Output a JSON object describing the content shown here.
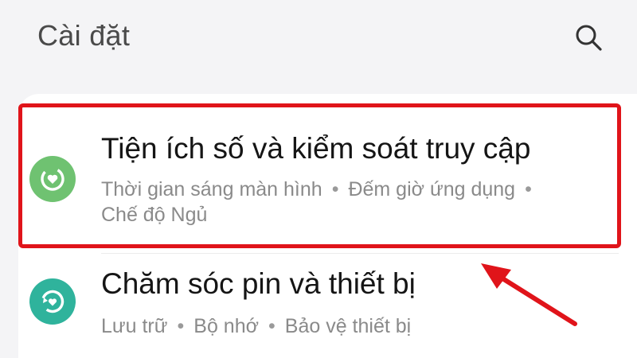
{
  "header": {
    "title": "Cài đặt",
    "search_icon": "search-icon"
  },
  "items": [
    {
      "title": "Tiện ích số và kiểm soát truy cập",
      "subtitle_parts": [
        "Thời gian sáng màn hình",
        "Đếm giờ ứng dụng",
        "Chế độ Ngủ"
      ],
      "separator": "•",
      "icon": "digital-wellbeing-icon",
      "icon_color": "#6fc271",
      "highlighted": true
    },
    {
      "title": "Chăm sóc pin và thiết bị",
      "subtitle_parts": [
        "Lưu trữ",
        "Bộ nhớ",
        "Bảo vệ thiết bị"
      ],
      "separator": "•",
      "icon": "device-care-icon",
      "icon_color": "#2fb39c",
      "highlighted": false
    }
  ],
  "annotation": {
    "highlight_color": "#e0141a",
    "arrow_color": "#e0141a"
  }
}
